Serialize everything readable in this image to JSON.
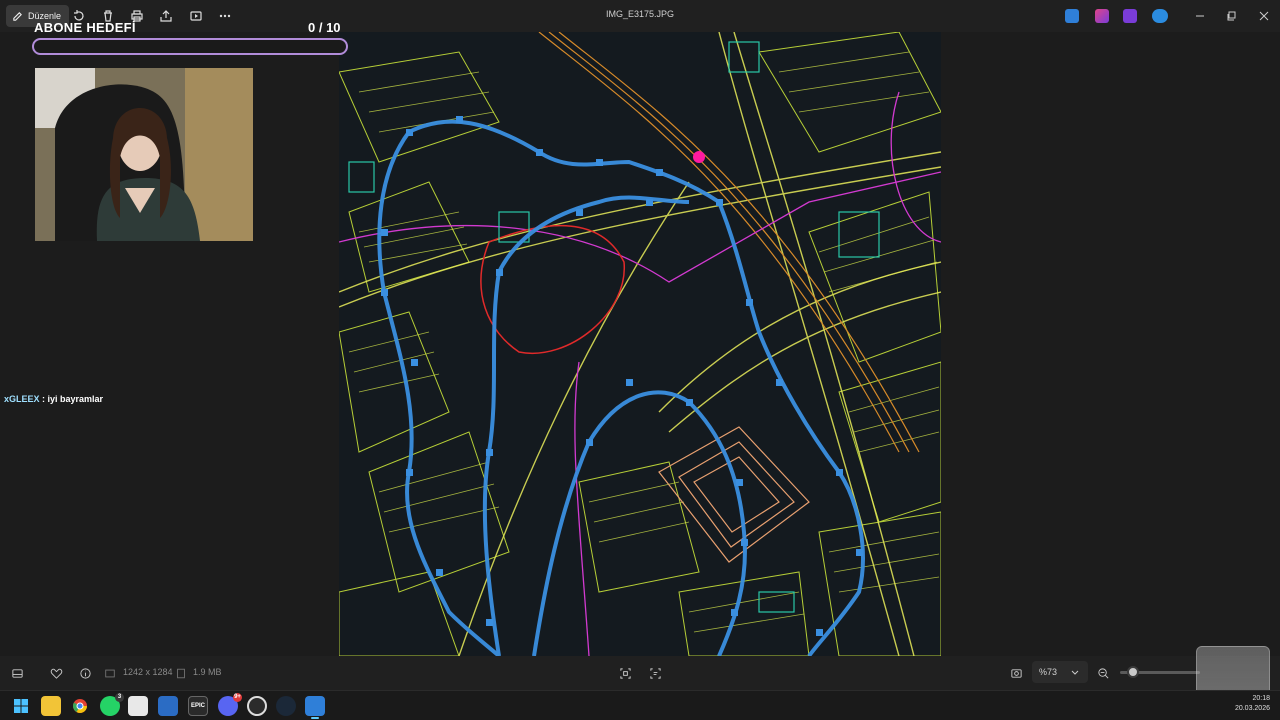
{
  "window": {
    "title": "IMG_E3175.JPG",
    "edit_label": "Düzenle"
  },
  "toolbar": {
    "items": [
      {
        "name": "rotate-icon"
      },
      {
        "name": "delete-icon"
      },
      {
        "name": "print-icon"
      },
      {
        "name": "share-icon"
      },
      {
        "name": "slideshow-icon"
      },
      {
        "name": "more-icon"
      }
    ]
  },
  "overlay": {
    "goal_title": "ABONE HEDEFİ",
    "goal_count": "0  / 10",
    "goal_progress": 0.0,
    "chat_user": "xGLEEX",
    "chat_separator": " : ",
    "chat_message": "iyi bayramlar"
  },
  "statusbar": {
    "dimensions": "1242 x 1284",
    "file_size": "1.9 MB",
    "zoom": "%73"
  },
  "clock": {
    "time": "20:18",
    "date": "20.03.2026"
  },
  "taskbar": {
    "apps": [
      {
        "name": "windows-start-icon",
        "badge": ""
      },
      {
        "name": "file-explorer-icon",
        "badge": ""
      },
      {
        "name": "chrome-icon",
        "badge": ""
      },
      {
        "name": "whatsapp-icon",
        "badge": "3"
      },
      {
        "name": "snipping-tool-icon",
        "badge": ""
      },
      {
        "name": "photos-icon",
        "badge": ""
      },
      {
        "name": "epic-games-icon",
        "badge": ""
      },
      {
        "name": "discord-icon",
        "badge": "9+"
      },
      {
        "name": "obs-icon",
        "badge": ""
      },
      {
        "name": "steam-icon",
        "badge": ""
      },
      {
        "name": "photos-viewer-icon",
        "badge": ""
      }
    ]
  },
  "colors": {
    "accent": "#60cdff",
    "goal_border": "#b18cd9",
    "route": "#3a8fe0"
  }
}
